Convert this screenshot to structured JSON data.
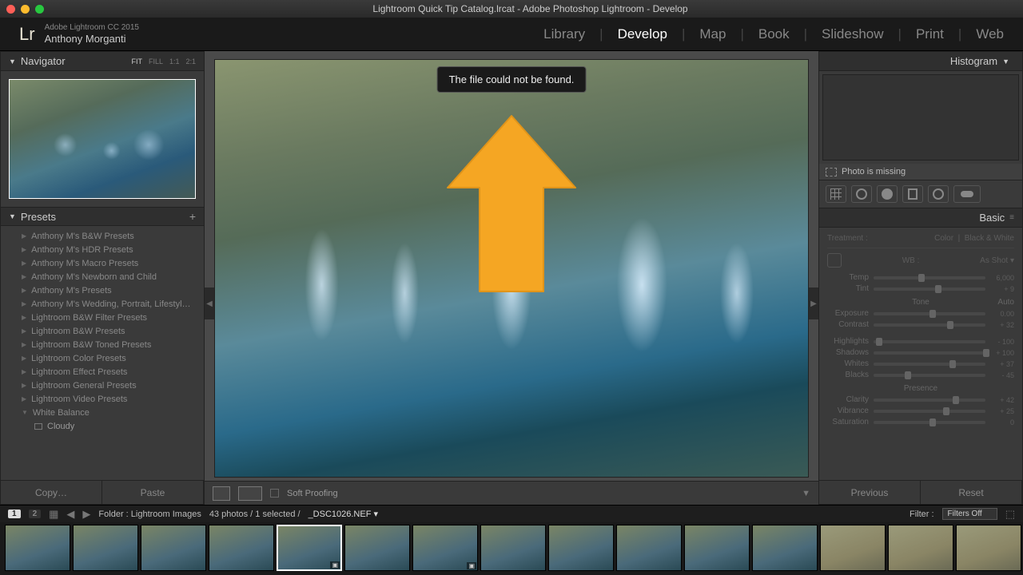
{
  "titlebar": {
    "title": "Lightroom Quick Tip Catalog.lrcat - Adobe Photoshop Lightroom - Develop",
    "dots": [
      "#ff5f57",
      "#febc2e",
      "#28c840"
    ]
  },
  "header": {
    "logo": "Lr",
    "app_line": "Adobe Lightroom CC 2015",
    "user_name": "Anthony Morganti",
    "modules": [
      "Library",
      "Develop",
      "Map",
      "Book",
      "Slideshow",
      "Print",
      "Web"
    ],
    "active_module": "Develop"
  },
  "left": {
    "navigator": {
      "title": "Navigator",
      "opts": [
        "FIT",
        "FILL",
        "1:1",
        "2:1"
      ],
      "selected": "FIT"
    },
    "presets": {
      "title": "Presets",
      "items": [
        "Anthony M's B&W Presets",
        "Anthony M's HDR Presets",
        "Anthony M's Macro Presets",
        "Anthony M's Newborn and Child",
        "Anthony M's Presets",
        "Anthony M's Wedding, Portrait, Lifestyl…",
        "Lightroom B&W Filter Presets",
        "Lightroom B&W Presets",
        "Lightroom B&W Toned Presets",
        "Lightroom Color Presets",
        "Lightroom Effect Presets",
        "Lightroom General Presets",
        "Lightroom Video Presets"
      ],
      "open_item": "White Balance",
      "sub_item": "Cloudy",
      "copy": "Copy…",
      "paste": "Paste"
    }
  },
  "center": {
    "tooltip": "The file could not be found.",
    "soft_proofing": "Soft Proofing"
  },
  "right": {
    "histogram": "Histogram",
    "missing": "Photo is missing",
    "basic": {
      "title": "Basic",
      "treatment": "Treatment :",
      "color": "Color",
      "bw": "Black & White",
      "wb_label": "WB :",
      "wb_value": "As Shot",
      "temp": {
        "label": "Temp",
        "value": "6,000",
        "pos": 40
      },
      "tint": {
        "label": "Tint",
        "value": "+ 9",
        "pos": 55
      },
      "tone": "Tone",
      "auto": "Auto",
      "sliders": [
        {
          "label": "Exposure",
          "value": "0.00",
          "pos": 50
        },
        {
          "label": "Contrast",
          "value": "+ 32",
          "pos": 66
        }
      ],
      "sliders2": [
        {
          "label": "Highlights",
          "value": "- 100",
          "pos": 2
        },
        {
          "label": "Shadows",
          "value": "+ 100",
          "pos": 98
        },
        {
          "label": "Whites",
          "value": "+ 37",
          "pos": 68
        },
        {
          "label": "Blacks",
          "value": "- 45",
          "pos": 28
        }
      ],
      "presence": "Presence",
      "sliders3": [
        {
          "label": "Clarity",
          "value": "+ 42",
          "pos": 71
        },
        {
          "label": "Vibrance",
          "value": "+ 25",
          "pos": 62
        },
        {
          "label": "Saturation",
          "value": "0",
          "pos": 50
        }
      ]
    },
    "previous": "Previous",
    "reset": "Reset"
  },
  "filmstrip": {
    "badges": [
      "1",
      "2"
    ],
    "path": "Folder : Lightroom Images",
    "count": "43 photos / 1 selected /",
    "file": "_DSC1026.NEF",
    "filter_label": "Filter :",
    "filter_value": "Filters Off",
    "thumbs": 16,
    "selected_index": 4,
    "alt_start": 12
  }
}
